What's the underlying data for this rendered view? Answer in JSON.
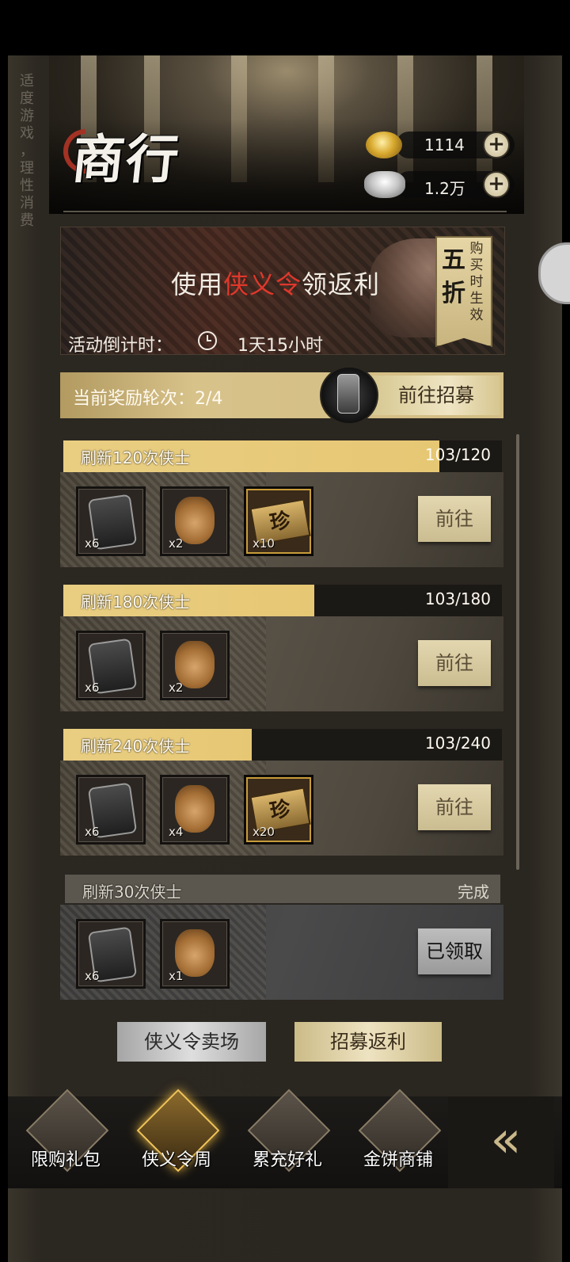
{
  "side_note": "适度游戏，理性消费",
  "header": {
    "title": "商行",
    "gold": {
      "icon": "gold-ingot-icon",
      "value": "1114"
    },
    "silver": {
      "icon": "silver-ingot-icon",
      "value": "1.2万"
    }
  },
  "promo": {
    "text_before": "使用",
    "text_highlight": "侠义令",
    "text_after": "领返利",
    "tag_big": "五折",
    "tag_small": "购买时生效",
    "countdown_label": "活动倒计时：",
    "countdown_value": "1天15小时"
  },
  "round": {
    "text": "当前奖励轮次：2/4",
    "button": "前往招募"
  },
  "tasks": [
    {
      "title": "刷新120次侠士",
      "count": "103/120",
      "progress": 0.858,
      "button": "前往",
      "items": [
        {
          "type": "token",
          "qty": "x6"
        },
        {
          "type": "bag",
          "qty": "x2"
        },
        {
          "type": "ticket",
          "qty": "x10"
        }
      ]
    },
    {
      "title": "刷新180次侠士",
      "count": "103/180",
      "progress": 0.572,
      "button": "前往",
      "items": [
        {
          "type": "token",
          "qty": "x6"
        },
        {
          "type": "bag",
          "qty": "x2"
        }
      ]
    },
    {
      "title": "刷新240次侠士",
      "count": "103/240",
      "progress": 0.429,
      "button": "前往",
      "items": [
        {
          "type": "token",
          "qty": "x6"
        },
        {
          "type": "bag",
          "qty": "x4"
        },
        {
          "type": "ticket",
          "qty": "x20"
        }
      ]
    },
    {
      "title": "刷新30次侠士",
      "count": "完成",
      "progress": 1.0,
      "button": "已领取",
      "items": [
        {
          "type": "token",
          "qty": "x6"
        },
        {
          "type": "bag",
          "qty": "x1"
        }
      ]
    }
  ],
  "ticket_glyph": "珍",
  "bottom_tabs": [
    "侠义令卖场",
    "招募返利"
  ],
  "nav": [
    {
      "label": "限购礼包",
      "icon": "gift-box-icon"
    },
    {
      "label": "侠义令周",
      "icon": "token-week-icon",
      "active": true
    },
    {
      "label": "累充好礼",
      "icon": "bowls-icon"
    },
    {
      "label": "金饼商铺",
      "icon": "gold-cakes-icon"
    }
  ],
  "nav_collapse": "«"
}
